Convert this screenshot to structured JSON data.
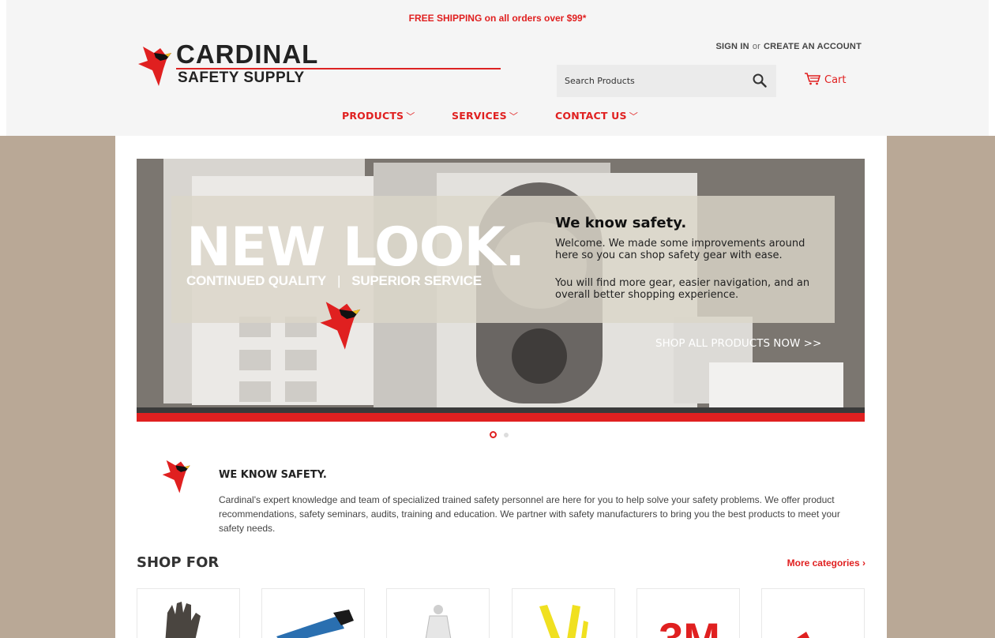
{
  "promo": "FREE SHIPPING on all orders over $99*",
  "brand": {
    "line1": "CARDINAL",
    "line2": "SAFETY SUPPLY"
  },
  "account": {
    "sign_in": "SIGN IN",
    "or": "or",
    "create": "CREATE AN ACCOUNT"
  },
  "search": {
    "placeholder": "Search Products"
  },
  "cart": {
    "label": "Cart"
  },
  "nav": {
    "products": "PRODUCTS",
    "services": "SERVICES",
    "contact": "CONTACT US"
  },
  "hero": {
    "headline": "NEW LOOK.",
    "tagline_left": "CONTINUED QUALITY",
    "tagline_sep": "|",
    "tagline_right": "SUPERIOR SERVICE",
    "title": "We know safety.",
    "welcome": "Welcome. We made some improvements around here so you can shop safety gear with ease.",
    "more": "You will find more gear, easier navigation, and an overall better shopping experience.",
    "cta": "SHOP ALL PRODUCTS NOW >>",
    "slide_count": 2,
    "active_slide": 1
  },
  "about": {
    "title": "WE KNOW SAFETY.",
    "text": "Cardinal's expert knowledge and team of specialized trained safety personnel are here for you to help solve your safety problems. We offer product recommendations, safety seminars, audits, training and education. We partner with safety manufacturers to bring you the best products to meet your safety needs."
  },
  "shop": {
    "title": "SHOP FOR",
    "more": "More categories ›",
    "tiles": [
      "gloves-image",
      "tool-image",
      "coverall-image",
      "harness-image",
      "3m-logo-image",
      "red-product-image"
    ]
  },
  "colors": {
    "accent": "#e02020",
    "page_bg": "#b9a896",
    "header_bg": "#f5f5f5"
  }
}
